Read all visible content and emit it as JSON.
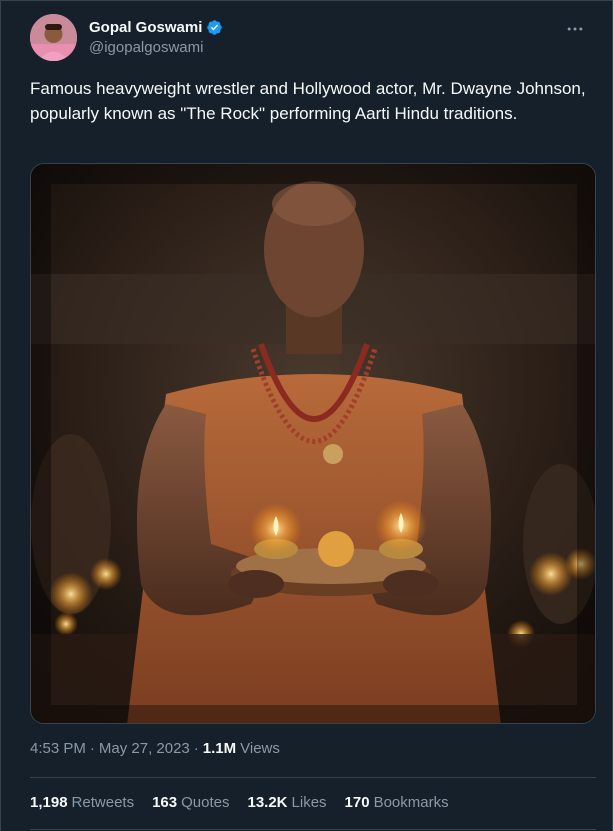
{
  "author": {
    "display_name": "Gopal Goswami",
    "handle": "@igopalgoswami",
    "verified": true
  },
  "icons": {
    "verified": "verified-badge-icon",
    "more": "more-options-icon",
    "avatar": "avatar"
  },
  "tweet": {
    "text": "Famous heavyweight wrestler and Hollywood actor, Mr. Dwayne Johnson, popularly known as \"The Rock\" performing Aarti Hindu traditions."
  },
  "meta": {
    "time": "4:53 PM",
    "separator1": "·",
    "date": "May 27, 2023",
    "separator2": "·",
    "views_count": "1.1M",
    "views_label": "Views"
  },
  "stats": {
    "retweets_count": "1,198",
    "retweets_label": "Retweets",
    "quotes_count": "163",
    "quotes_label": "Quotes",
    "likes_count": "13.2K",
    "likes_label": "Likes",
    "bookmarks_count": "170",
    "bookmarks_label": "Bookmarks"
  },
  "colors": {
    "background": "#15202b",
    "text_primary": "#f7f9f9",
    "text_secondary": "#8b98a5",
    "border": "#38444d",
    "verified_blue": "#1d9bf0"
  }
}
